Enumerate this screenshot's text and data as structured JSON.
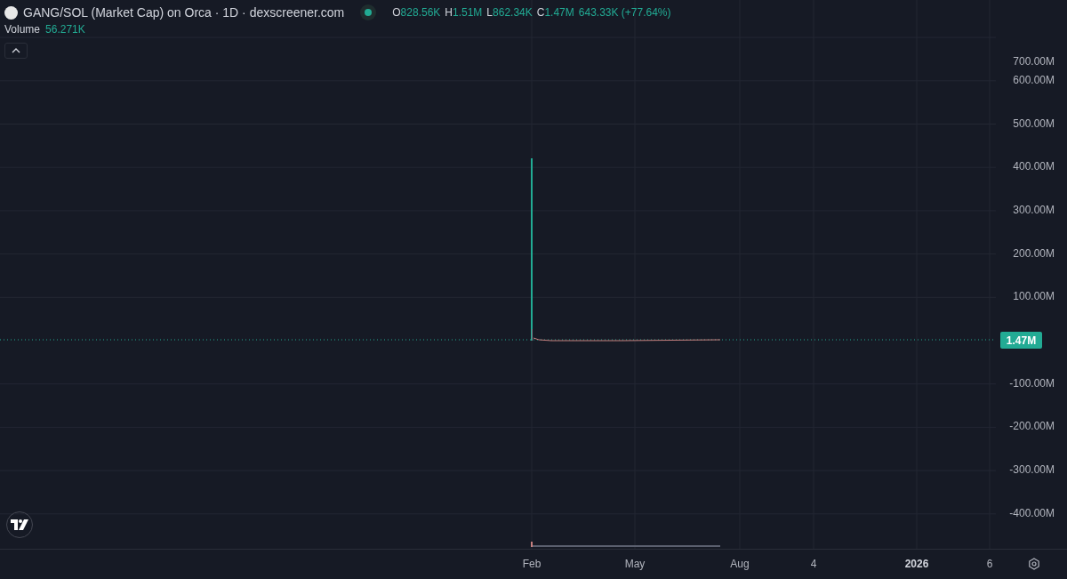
{
  "legend": {
    "title": "GANG/SOL (Market Cap) on Orca · 1D · dexscreener.com",
    "live": true,
    "ohlc": [
      {
        "key": "O",
        "value": "828.56K"
      },
      {
        "key": "H",
        "value": "1.51M"
      },
      {
        "key": "L",
        "value": "862.34K"
      },
      {
        "key": "C",
        "value": "1.47M"
      }
    ],
    "change": "643.33K (+77.64%)",
    "volume": {
      "label": "Volume",
      "value": "56.271K"
    }
  },
  "price_axis": {
    "labels": [
      "700.00M",
      "600.00M",
      "500.00M",
      "400.00M",
      "300.00M",
      "200.00M",
      "100.00M",
      "-100.00M",
      "-200.00M",
      "-300.00M",
      "-400.00M"
    ],
    "last_price": "1.47M"
  },
  "time_axis": {
    "labels": [
      {
        "text": "Feb",
        "kind": "month"
      },
      {
        "text": "May",
        "kind": "month"
      },
      {
        "text": "Aug",
        "kind": "month"
      },
      {
        "text": "4",
        "kind": "day"
      },
      {
        "text": "2026",
        "kind": "year"
      },
      {
        "text": "6",
        "kind": "day"
      }
    ]
  }
}
